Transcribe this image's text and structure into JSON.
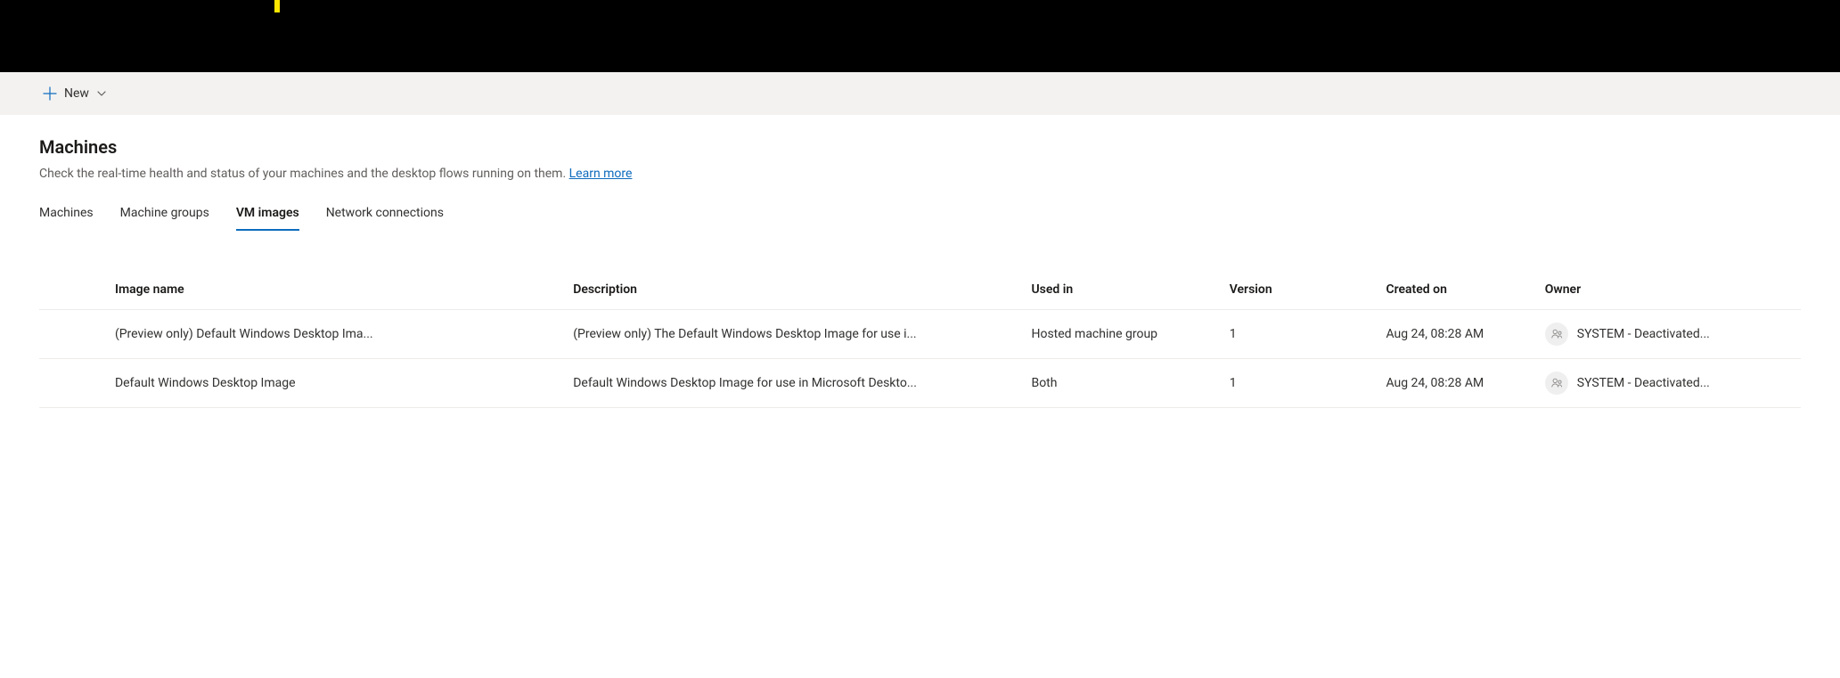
{
  "toolbar": {
    "new_label": "New"
  },
  "page": {
    "title": "Machines",
    "subtitle_text": "Check the real-time health and status of your machines and the desktop flows running on them. ",
    "learn_more": "Learn more"
  },
  "tabs": [
    {
      "label": "Machines",
      "active": false
    },
    {
      "label": "Machine groups",
      "active": false
    },
    {
      "label": "VM images",
      "active": true
    },
    {
      "label": "Network connections",
      "active": false
    }
  ],
  "table": {
    "headers": {
      "name": "Image name",
      "description": "Description",
      "used_in": "Used in",
      "version": "Version",
      "created_on": "Created on",
      "owner": "Owner"
    },
    "rows": [
      {
        "name": "(Preview only) Default Windows Desktop Ima...",
        "description": "(Preview only) The Default Windows Desktop Image for use i...",
        "used_in": "Hosted machine group",
        "version": "1",
        "created_on": "Aug 24, 08:28 AM",
        "owner": "SYSTEM - Deactivated..."
      },
      {
        "name": "Default Windows Desktop Image",
        "description": "Default Windows Desktop Image for use in Microsoft Deskto...",
        "used_in": "Both",
        "version": "1",
        "created_on": "Aug 24, 08:28 AM",
        "owner": "SYSTEM - Deactivated..."
      }
    ]
  }
}
